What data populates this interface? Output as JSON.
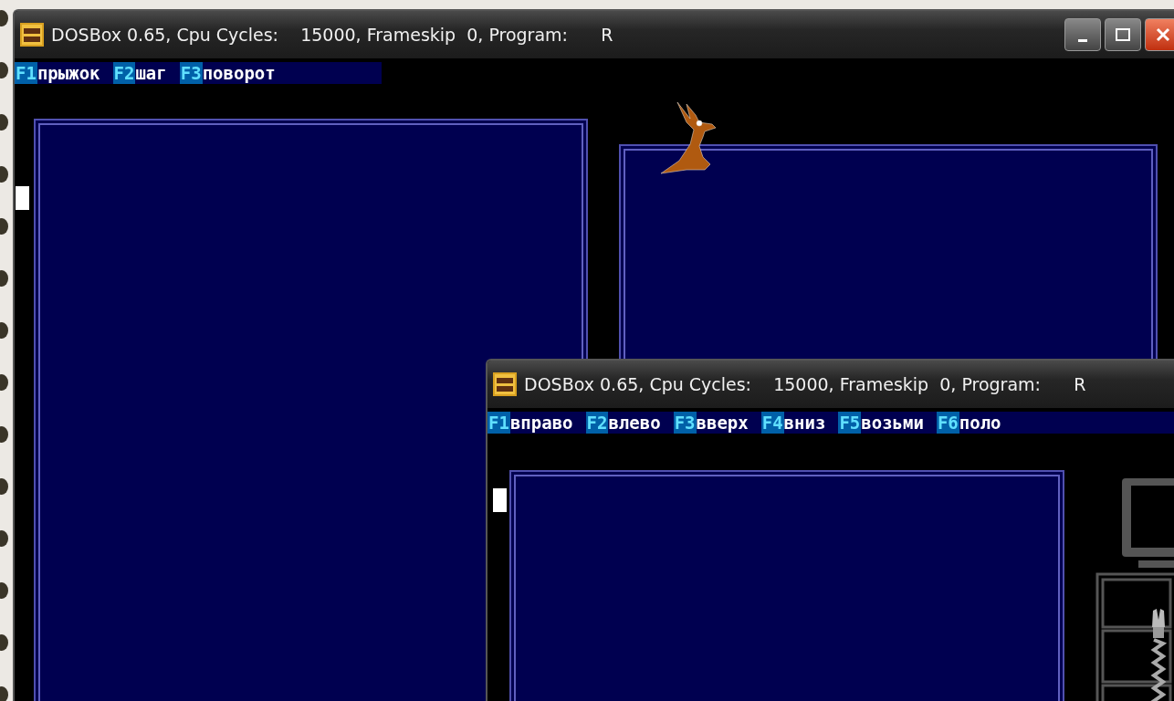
{
  "windows": [
    {
      "title": "DOSBox 0.65, Cpu Cycles:    15000, Frameskip  0, Program:      R",
      "caption_buttons": true,
      "menu": [
        {
          "key": "F1",
          "label": "прыжок"
        },
        {
          "key": "F2",
          "label": "шаг"
        },
        {
          "key": "F3",
          "label": "поворот"
        }
      ]
    },
    {
      "title": "DOSBox 0.65, Cpu Cycles:    15000, Frameskip  0, Program:      R",
      "caption_buttons": false,
      "menu": [
        {
          "key": "F1",
          "label": "вправо"
        },
        {
          "key": "F2",
          "label": "влево"
        },
        {
          "key": "F3",
          "label": "вверх"
        },
        {
          "key": "F4",
          "label": "вниз"
        },
        {
          "key": "F5",
          "label": "возьми"
        },
        {
          "key": "F6",
          "label": "поло"
        }
      ]
    }
  ]
}
